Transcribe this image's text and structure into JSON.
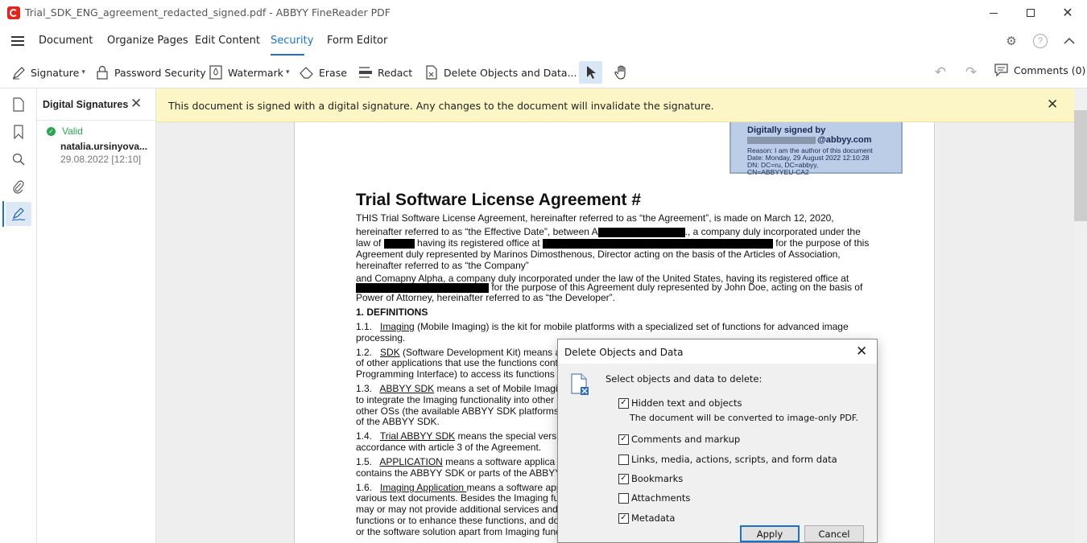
{
  "window": {
    "title": "Trial_SDK_ENG_agreement_redacted_signed.pdf - ABBYY FineReader PDF"
  },
  "menu": {
    "items": [
      "Document",
      "Organize Pages",
      "Edit Content",
      "Security",
      "Form Editor"
    ],
    "active": "Security"
  },
  "toolbar": {
    "signature": "Signature",
    "password_security": "Password Security",
    "watermark": "Watermark",
    "erase": "Erase",
    "redact": "Redact",
    "delete_objects": "Delete Objects and Data...",
    "comments": "Comments (0)"
  },
  "signatures_panel": {
    "title": "Digital Signatures",
    "status": "Valid",
    "signer": "natalia.ursinyova...",
    "date": "29.08.2022 [12:10]"
  },
  "banner": {
    "text": "This document is signed with a digital signature. Any changes to the document will invalidate the signature."
  },
  "stamp": {
    "title": "Digitally signed by",
    "email_suffix": "@abbyy.com",
    "reason": "Reason: I am the author of this document",
    "date": "Date: Monday, 29 August 2022 12:10:28",
    "dn": "DN: DC=ru, DC=abbyy,",
    "cn": "CN=ABBYYEU-CA2"
  },
  "document": {
    "title": "Trial Software License Agreement #",
    "p1_l1": "THIS Trial Software License Agreement, hereinafter referred to as “the Agreement”, is made on March 12, 2020,",
    "p1_l2a": "hereinafter referred to as “the Effective Date”, between A",
    "p1_l2b": "., a company duly incorporated under the",
    "p1_l3a": "law of",
    "p1_l3b": "having its registered office at",
    "p1_l3c": "for the purpose of this",
    "p1_l4": "Agreement duly represented by Marinos Dimosthenous, Director acting on the basis of the Articles of Association,",
    "p1_l5": "hereinafter referred to as “the Company”",
    "p2_l1": "and Comapny Alpha, a company duly incorporated under the law of the United States, having its registered office at",
    "p2_l2b": "for  the  purpose  of this Agreement duly represented by John Doe, acting on the basis of",
    "p2_l3": "Power of Attorney, hereinafter referred to as “the Developer”.",
    "h1": "1.    DEFINITIONS",
    "d11_num": "1.1.",
    "d11_term": "Imaging",
    "d11_rest": " (Mobile Imaging) is the kit for mobile platforms with a specialized set of functions for advanced image",
    "d11_l2": "processing.",
    "d12_num": "1.2.",
    "d12_term": "SDK",
    "d12_rest": " (Software Development Kit) means ar",
    "d12_l2": "of other applications that use the functions conta",
    "d12_l3": "Programming Interface) to access its functions p",
    "d13_num": "1.3.",
    "d13_term": "ABBYY SDK",
    "d13_rest": " means a set of Mobile Imagin",
    "d13_l2": "to integrate the Imaging functionality into other s",
    "d13_l3": "other OSs (the available ABBYY SDK platforms",
    "d13_l4": "of the ABBYY SDK.",
    "d14_num": "1.4.",
    "d14_term": "Trial ABBYY SDK",
    "d14_rest": " means the special versio",
    "d14_l2": "accordance with article 3 of the Agreement.",
    "d15_num": "1.5.",
    "d15_term": "APPLICATION",
    "d15_rest": " means a software applica",
    "d15_l2": "contains the ABBYY SDK or parts of the ABBYY",
    "d16_num": "1.6.",
    "d16_term": "Imaging Application ",
    "d16_rest": "means a software app",
    "d16_l2": "various text documents. Besides the Imaging fun",
    "d16_l3": "may or may not provide additional services and",
    "d16_l4": "functions or to enhance these functions, and do n",
    "d16_l5": "or the software solution apart from Imaging funct"
  },
  "dialog": {
    "title": "Delete Objects and Data",
    "prompt": "Select objects and data to delete:",
    "options": [
      {
        "label": "Hidden text and objects",
        "checked": true
      },
      {
        "label": "Comments and markup",
        "checked": true
      },
      {
        "label": "Links, media, actions, scripts, and form data",
        "checked": false
      },
      {
        "label": "Bookmarks",
        "checked": true
      },
      {
        "label": "Attachments",
        "checked": false
      },
      {
        "label": "Metadata",
        "checked": true
      }
    ],
    "hidden_note": "The document will be converted to image-only PDF.",
    "apply": "Apply",
    "cancel": "Cancel"
  }
}
